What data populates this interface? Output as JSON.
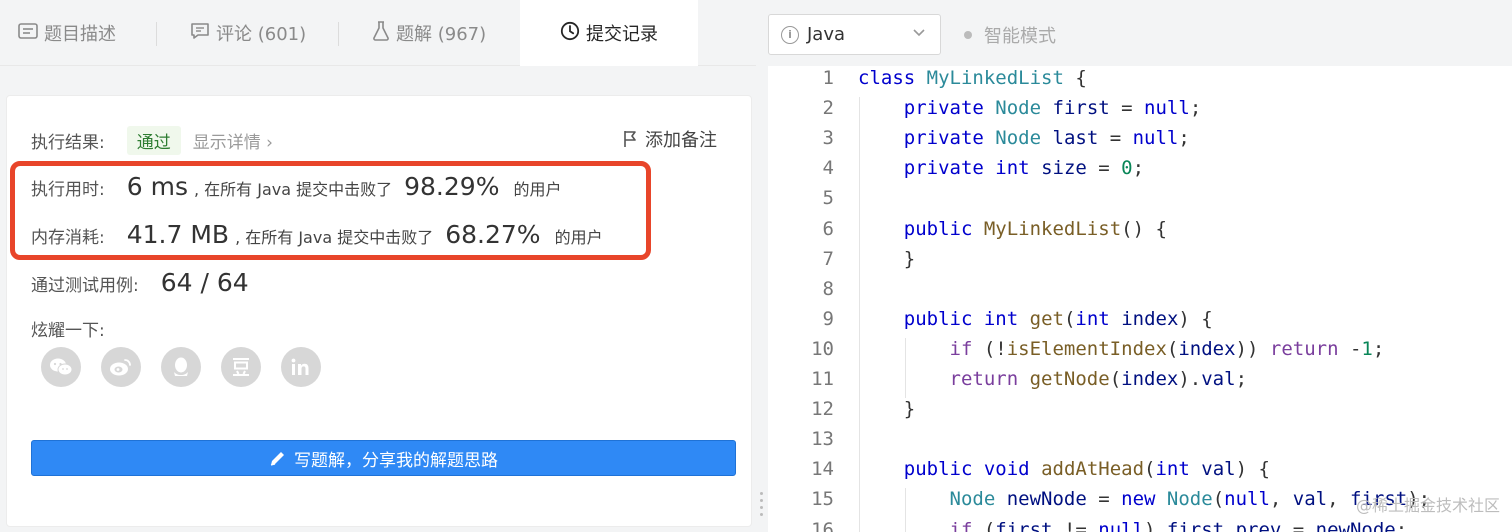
{
  "tabs": [
    {
      "label": "题目描述",
      "icon": "description-icon"
    },
    {
      "label": "评论 (601)",
      "icon": "comment-icon"
    },
    {
      "label": "题解 (967)",
      "icon": "flask-icon"
    },
    {
      "label": "提交记录",
      "icon": "clock-icon",
      "active": true
    }
  ],
  "result": {
    "label": "执行结果:",
    "status": "通过",
    "detail": "显示详情 ›",
    "note": "添加备注",
    "runtime_label": "执行用时:",
    "runtime_value": "6 ms",
    "runtime_mid": ", 在所有 Java 提交中击败了",
    "runtime_pct": "98.29%",
    "runtime_tail": "的用户",
    "memory_label": "内存消耗:",
    "memory_value": "41.7 MB",
    "memory_mid": ", 在所有 Java 提交中击败了",
    "memory_pct": "68.27%",
    "memory_tail": "的用户",
    "tests_label": "通过测试用例:",
    "tests_value": "64 / 64",
    "share_label": "炫耀一下:",
    "write_button": "写题解，分享我的解题思路"
  },
  "social": [
    {
      "name": "wechat-icon",
      "glyph": "◕"
    },
    {
      "name": "weibo-icon",
      "glyph": "◉"
    },
    {
      "name": "qq-icon",
      "glyph": "☺"
    },
    {
      "name": "douban-icon",
      "glyph": "豆"
    },
    {
      "name": "linkedin-icon",
      "glyph": "in"
    }
  ],
  "editor": {
    "language": "Java",
    "mode": "智能模式"
  },
  "code_lines": [
    "class MyLinkedList {",
    "    private Node first = null;",
    "    private Node last = null;",
    "    private int size = 0;",
    "",
    "    public MyLinkedList() {",
    "    }",
    "",
    "    public int get(int index) {",
    "        if (!isElementIndex(index)) return -1;",
    "        return getNode(index).val;",
    "    }",
    "",
    "    public void addAtHead(int val) {",
    "        Node newNode = new Node(null, val, first);",
    "        if (first != null) first.prev = newNode;"
  ],
  "watermark": "@稀土掘金技术社区"
}
